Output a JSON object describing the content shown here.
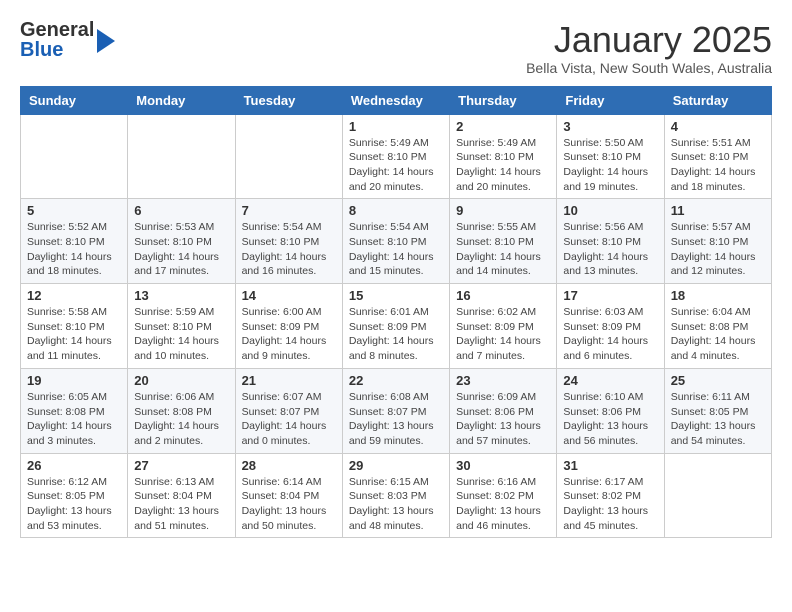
{
  "header": {
    "logo_general": "General",
    "logo_blue": "Blue",
    "month_title": "January 2025",
    "location": "Bella Vista, New South Wales, Australia"
  },
  "days_of_week": [
    "Sunday",
    "Monday",
    "Tuesday",
    "Wednesday",
    "Thursday",
    "Friday",
    "Saturday"
  ],
  "weeks": [
    [
      {
        "day": "",
        "info": ""
      },
      {
        "day": "",
        "info": ""
      },
      {
        "day": "",
        "info": ""
      },
      {
        "day": "1",
        "info": "Sunrise: 5:49 AM\nSunset: 8:10 PM\nDaylight: 14 hours\nand 20 minutes."
      },
      {
        "day": "2",
        "info": "Sunrise: 5:49 AM\nSunset: 8:10 PM\nDaylight: 14 hours\nand 20 minutes."
      },
      {
        "day": "3",
        "info": "Sunrise: 5:50 AM\nSunset: 8:10 PM\nDaylight: 14 hours\nand 19 minutes."
      },
      {
        "day": "4",
        "info": "Sunrise: 5:51 AM\nSunset: 8:10 PM\nDaylight: 14 hours\nand 18 minutes."
      }
    ],
    [
      {
        "day": "5",
        "info": "Sunrise: 5:52 AM\nSunset: 8:10 PM\nDaylight: 14 hours\nand 18 minutes."
      },
      {
        "day": "6",
        "info": "Sunrise: 5:53 AM\nSunset: 8:10 PM\nDaylight: 14 hours\nand 17 minutes."
      },
      {
        "day": "7",
        "info": "Sunrise: 5:54 AM\nSunset: 8:10 PM\nDaylight: 14 hours\nand 16 minutes."
      },
      {
        "day": "8",
        "info": "Sunrise: 5:54 AM\nSunset: 8:10 PM\nDaylight: 14 hours\nand 15 minutes."
      },
      {
        "day": "9",
        "info": "Sunrise: 5:55 AM\nSunset: 8:10 PM\nDaylight: 14 hours\nand 14 minutes."
      },
      {
        "day": "10",
        "info": "Sunrise: 5:56 AM\nSunset: 8:10 PM\nDaylight: 14 hours\nand 13 minutes."
      },
      {
        "day": "11",
        "info": "Sunrise: 5:57 AM\nSunset: 8:10 PM\nDaylight: 14 hours\nand 12 minutes."
      }
    ],
    [
      {
        "day": "12",
        "info": "Sunrise: 5:58 AM\nSunset: 8:10 PM\nDaylight: 14 hours\nand 11 minutes."
      },
      {
        "day": "13",
        "info": "Sunrise: 5:59 AM\nSunset: 8:10 PM\nDaylight: 14 hours\nand 10 minutes."
      },
      {
        "day": "14",
        "info": "Sunrise: 6:00 AM\nSunset: 8:09 PM\nDaylight: 14 hours\nand 9 minutes."
      },
      {
        "day": "15",
        "info": "Sunrise: 6:01 AM\nSunset: 8:09 PM\nDaylight: 14 hours\nand 8 minutes."
      },
      {
        "day": "16",
        "info": "Sunrise: 6:02 AM\nSunset: 8:09 PM\nDaylight: 14 hours\nand 7 minutes."
      },
      {
        "day": "17",
        "info": "Sunrise: 6:03 AM\nSunset: 8:09 PM\nDaylight: 14 hours\nand 6 minutes."
      },
      {
        "day": "18",
        "info": "Sunrise: 6:04 AM\nSunset: 8:08 PM\nDaylight: 14 hours\nand 4 minutes."
      }
    ],
    [
      {
        "day": "19",
        "info": "Sunrise: 6:05 AM\nSunset: 8:08 PM\nDaylight: 14 hours\nand 3 minutes."
      },
      {
        "day": "20",
        "info": "Sunrise: 6:06 AM\nSunset: 8:08 PM\nDaylight: 14 hours\nand 2 minutes."
      },
      {
        "day": "21",
        "info": "Sunrise: 6:07 AM\nSunset: 8:07 PM\nDaylight: 14 hours\nand 0 minutes."
      },
      {
        "day": "22",
        "info": "Sunrise: 6:08 AM\nSunset: 8:07 PM\nDaylight: 13 hours\nand 59 minutes."
      },
      {
        "day": "23",
        "info": "Sunrise: 6:09 AM\nSunset: 8:06 PM\nDaylight: 13 hours\nand 57 minutes."
      },
      {
        "day": "24",
        "info": "Sunrise: 6:10 AM\nSunset: 8:06 PM\nDaylight: 13 hours\nand 56 minutes."
      },
      {
        "day": "25",
        "info": "Sunrise: 6:11 AM\nSunset: 8:05 PM\nDaylight: 13 hours\nand 54 minutes."
      }
    ],
    [
      {
        "day": "26",
        "info": "Sunrise: 6:12 AM\nSunset: 8:05 PM\nDaylight: 13 hours\nand 53 minutes."
      },
      {
        "day": "27",
        "info": "Sunrise: 6:13 AM\nSunset: 8:04 PM\nDaylight: 13 hours\nand 51 minutes."
      },
      {
        "day": "28",
        "info": "Sunrise: 6:14 AM\nSunset: 8:04 PM\nDaylight: 13 hours\nand 50 minutes."
      },
      {
        "day": "29",
        "info": "Sunrise: 6:15 AM\nSunset: 8:03 PM\nDaylight: 13 hours\nand 48 minutes."
      },
      {
        "day": "30",
        "info": "Sunrise: 6:16 AM\nSunset: 8:02 PM\nDaylight: 13 hours\nand 46 minutes."
      },
      {
        "day": "31",
        "info": "Sunrise: 6:17 AM\nSunset: 8:02 PM\nDaylight: 13 hours\nand 45 minutes."
      },
      {
        "day": "",
        "info": ""
      }
    ]
  ]
}
